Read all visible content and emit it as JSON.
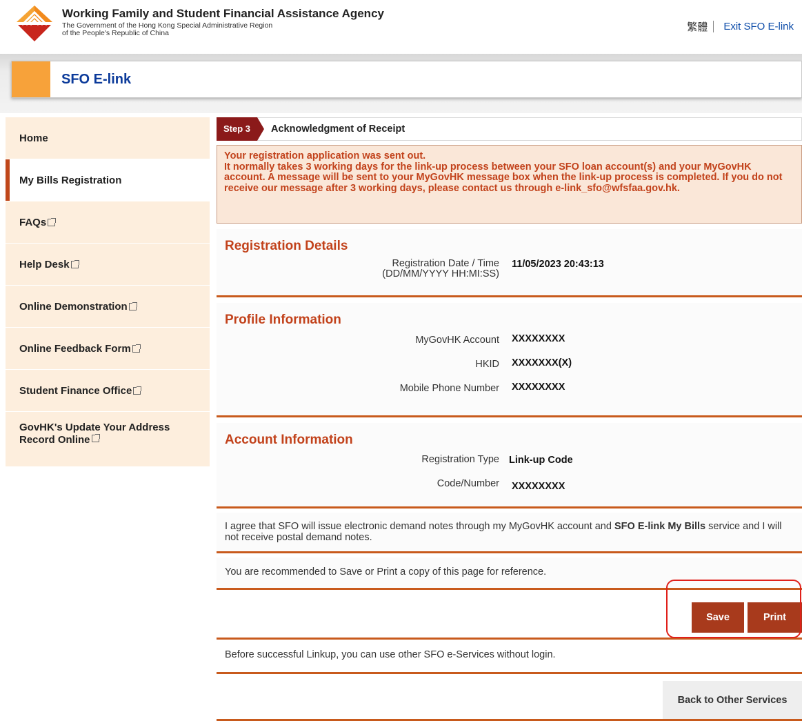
{
  "header": {
    "agency_title": "Working Family and Student Financial Assistance Agency",
    "agency_sub_1": "The Government of the Hong Kong Special Administrative Region",
    "agency_sub_2": "of the People's Republic of China",
    "lang_link": "繁體",
    "exit_link": "Exit SFO E-link"
  },
  "banner": {
    "title": "SFO E-link"
  },
  "sidebar": {
    "items": [
      {
        "label": "Home",
        "external": false
      },
      {
        "label": "My Bills Registration",
        "external": false,
        "active": true
      },
      {
        "label": "FAQs",
        "external": true
      },
      {
        "label": "Help Desk",
        "external": true
      },
      {
        "label": "Online Demonstration",
        "external": true
      },
      {
        "label": "Online Feedback Form",
        "external": true
      },
      {
        "label": "Student Finance Office",
        "external": true
      },
      {
        "label_line1": "GovHK's Update Your Address",
        "label_line2": "Record Online",
        "external": true
      }
    ]
  },
  "step": {
    "tag": "Step 3",
    "title": "Acknowledgment of Receipt"
  },
  "notice": {
    "line1": "Your registration application was sent out.",
    "line2": "It normally takes 3 working days for the link-up process between your SFO loan account(s) and your MyGovHK account. A message will be sent to your MyGovHK message box when the link-up process is completed. If you do not receive our message after 3 working days, please contact us through e-link_sfo@wfsfaa.gov.hk."
  },
  "registration": {
    "title": "Registration Details",
    "date_label_1": "Registration Date / Time",
    "date_label_2": "(DD/MM/YYYY HH:MI:SS)",
    "date_value": "11/05/2023 20:43:13"
  },
  "profile": {
    "title": "Profile Information",
    "account_label": "MyGovHK Account",
    "account_value": "XXXXXXXX",
    "hkid_label": "HKID",
    "hkid_value": "XXXXXXX(X)",
    "phone_label": "Mobile Phone Number",
    "phone_value": "XXXXXXXX"
  },
  "account": {
    "title": "Account Information",
    "type_label": "Registration Type",
    "type_value": "Link-up Code",
    "code_label": "Code/Number",
    "code_value": "XXXXXXXX"
  },
  "agreement": {
    "part1": "I agree that SFO will issue electronic demand notes through my MyGovHK account and ",
    "bold": "SFO E-link My Bills",
    "part2": " service and I will not receive postal demand notes."
  },
  "recommend_text": "You are recommended to Save or Print a copy of this page for reference.",
  "buttons": {
    "save": "Save",
    "print": "Print"
  },
  "linkup_text": "Before successful Linkup, you can use other SFO e-Services without login.",
  "back_button": "Back to Other Services",
  "colors": {
    "accent": "#c85a1c",
    "brand_blue": "#0b3a9a",
    "button": "#a83a1c",
    "highlight": "#e0201a"
  }
}
